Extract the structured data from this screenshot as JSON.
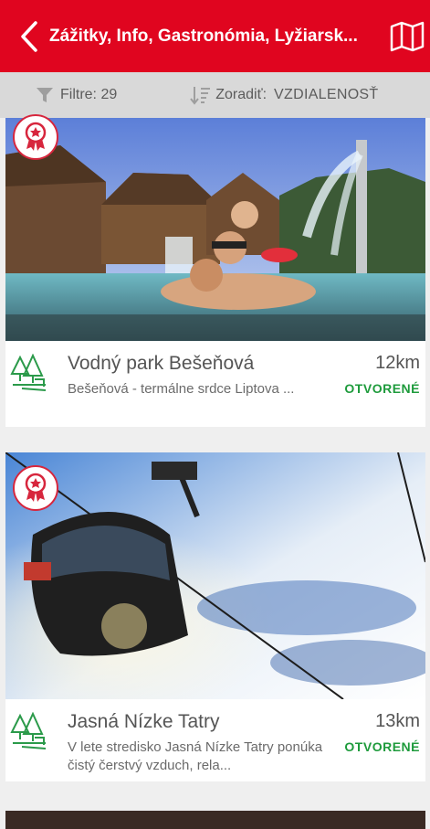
{
  "header": {
    "title": "Zážitky, Info, Gastronómia, Lyžiarsk..."
  },
  "toolbar": {
    "filter_label": "Filtre: 29",
    "sort_label": "Zoradiť:",
    "sort_value": "VZDIALENOSŤ"
  },
  "colors": {
    "brand": "#e0051f",
    "status_open": "#1e9b3c",
    "category_icon": "#2b9a4a"
  },
  "items": [
    {
      "name": "Vodný park Bešeňová",
      "description": "Bešeňová - termálne srdce Liptova ...",
      "distance": "12km",
      "status": "OTVORENÉ",
      "category_icon": "park-icon",
      "badge_icon": "award-badge-icon"
    },
    {
      "name": "Jasná Nízke Tatry",
      "description": "V lete stredisko Jasná Nízke Tatry ponúka čistý čerstvý vzduch, rela...",
      "distance": "13km",
      "status": "OTVORENÉ",
      "category_icon": "park-icon",
      "badge_icon": "award-badge-icon"
    }
  ]
}
